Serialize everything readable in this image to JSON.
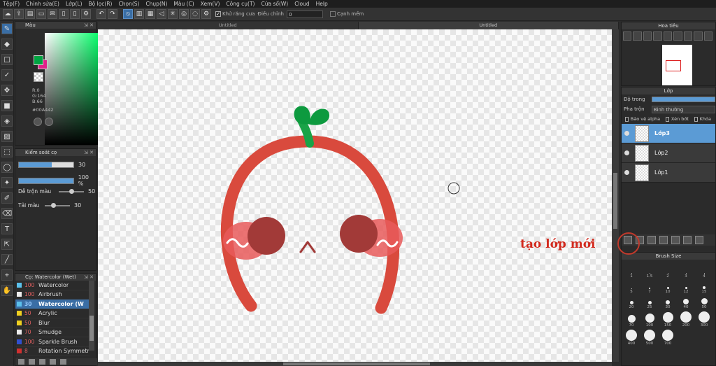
{
  "menu": [
    "Tệp(F)",
    "Chỉnh sửa(E)",
    "Lớp(L)",
    "Bộ lọc(R)",
    "Chọn(S)",
    "Chụp(N)",
    "Màu (C)",
    "Xem(V)",
    "Công cụ(T)",
    "Cửa sổ(W)",
    "Cloud",
    "Help"
  ],
  "toolbar": {
    "antialias_label": "Khử răng cưa",
    "adjust_label": "Điều chỉnh",
    "adjust_value": "0",
    "edge_label": "Cạnh mềm"
  },
  "color_panel": {
    "title": "Màu",
    "r": "R:0",
    "g": "G:164",
    "b": "B:66",
    "hex": "#00A442",
    "fg_color": "#00a442",
    "bg_color": "#e0218a"
  },
  "brush_control": {
    "title": "Kiểm soát cọ",
    "size_value": "30",
    "size_fraction": 0.3,
    "opacity_value": "100 %",
    "opacity_fraction": 1.0,
    "blend_label": "Dễ trộn màu",
    "blend_value": "50",
    "blend_fraction": 0.5,
    "reload_label": "Tải màu",
    "reload_value": "30",
    "reload_fraction": 0.3
  },
  "brush_list": {
    "title": "Cọ: Watercolor (Wet)",
    "items": [
      {
        "size": "100",
        "name": "Watercolor",
        "color": "#5bc0eb",
        "selected": false
      },
      {
        "size": "100",
        "name": "Airbrush",
        "color": "#eeeeee",
        "selected": false
      },
      {
        "size": "30",
        "name": "Watercolor (W",
        "color": "#5bc0eb",
        "selected": true
      },
      {
        "size": "50",
        "name": "Acrylic",
        "color": "#f0d020",
        "selected": false
      },
      {
        "size": "50",
        "name": "Blur",
        "color": "#f0d020",
        "selected": false
      },
      {
        "size": "70",
        "name": "Smudge",
        "color": "#eeeeee",
        "selected": false
      },
      {
        "size": "100",
        "name": "Sparkle Brush",
        "color": "#3050d0",
        "selected": false
      },
      {
        "size": "8",
        "name": "Rotation Symmetr",
        "color": "#d03030",
        "selected": false
      }
    ]
  },
  "tabs": [
    "Untitled",
    "Untitled"
  ],
  "navigator": {
    "title": "Hoa tiêu"
  },
  "layers": {
    "title": "Lớp",
    "opacity_label": "Độ trong",
    "blend_label": "Pha trộn",
    "blend_value": "Bình thường",
    "check_alpha": "Bảo vệ alpha",
    "check_clip": "Xén bớt",
    "check_lock": "Khóa",
    "items": [
      {
        "name": "Lớp3",
        "selected": true
      },
      {
        "name": "Lớp2",
        "selected": false
      },
      {
        "name": "Lớp1",
        "selected": false
      }
    ]
  },
  "annotation": "tạo lớp mới",
  "brush_size": {
    "title": "Brush Size",
    "labels": [
      "1",
      "1.5",
      "2",
      "3",
      "4",
      "5",
      "7",
      "10",
      "12",
      "15",
      "20",
      "25",
      "30",
      "40",
      "50",
      "70",
      "100",
      "150",
      "200",
      "300",
      "400",
      "500",
      "700"
    ]
  }
}
